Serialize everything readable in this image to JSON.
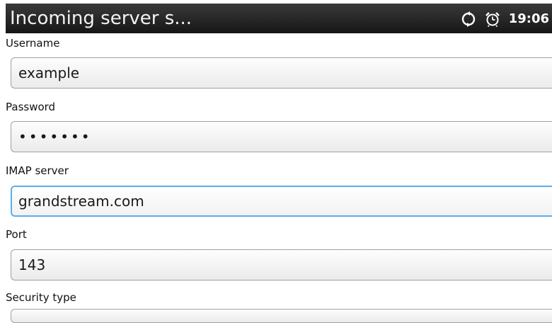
{
  "status_bar": {
    "title": "Incoming server s...",
    "time": "19:06",
    "icons": [
      "sync-icon",
      "alarm-clock-icon"
    ]
  },
  "form": {
    "username": {
      "label": "Username",
      "value": "example"
    },
    "password": {
      "label": "Password",
      "value": "•••••••"
    },
    "imap_server": {
      "label": "IMAP server",
      "value": "grandstream.com"
    },
    "port": {
      "label": "Port",
      "value": "143"
    },
    "security_type": {
      "label": "Security type"
    }
  },
  "colors": {
    "focus_border": "#5aaef0",
    "status_bar_bg": "#1c1c1c"
  }
}
